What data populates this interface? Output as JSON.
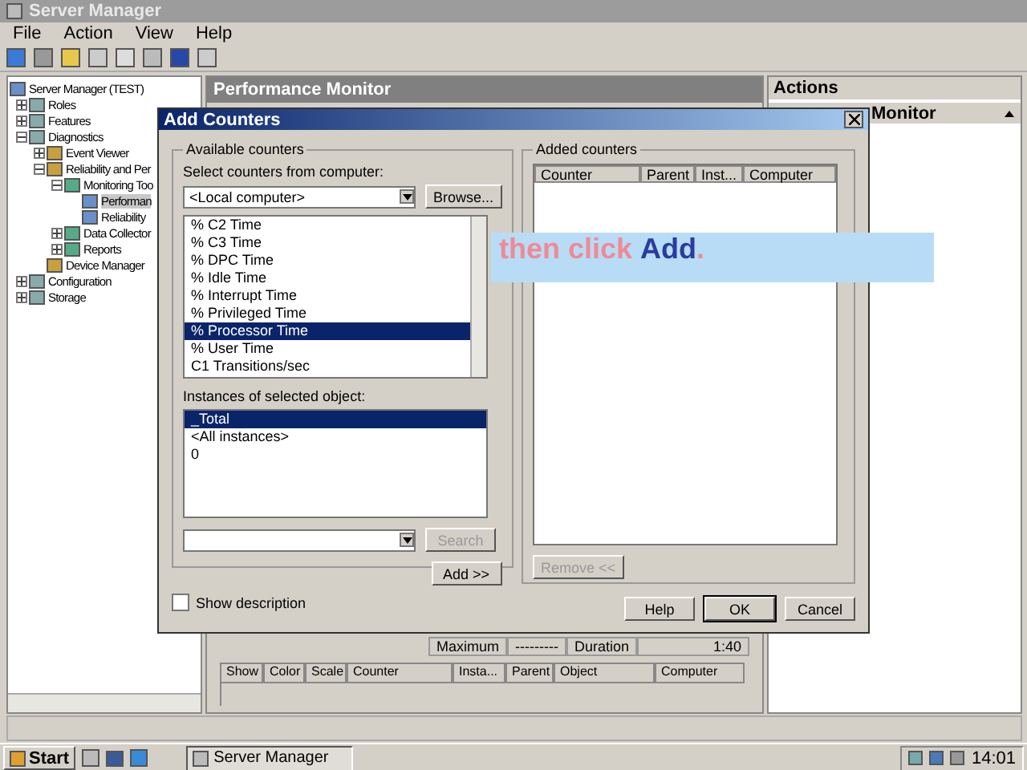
{
  "window": {
    "title": "Server Manager"
  },
  "menu": [
    "File",
    "Action",
    "View",
    "Help"
  ],
  "tree": [
    {
      "label": "Server Manager (TEST)",
      "selected": false,
      "children": [
        {
          "label": "Roles",
          "selected": false,
          "expanded": false
        },
        {
          "label": "Features",
          "selected": false,
          "expanded": false
        },
        {
          "label": "Diagnostics",
          "selected": false,
          "expanded": true,
          "children": [
            {
              "label": "Event Viewer",
              "selected": false,
              "expanded": false
            },
            {
              "label": "Reliability and Per",
              "selected": false,
              "expanded": true,
              "children": [
                {
                  "label": "Monitoring Too",
                  "selected": false,
                  "expanded": true,
                  "children": [
                    {
                      "label": "Performan",
                      "selected": true
                    },
                    {
                      "label": "Reliability",
                      "selected": false
                    }
                  ]
                },
                {
                  "label": "Data Collector",
                  "selected": false,
                  "expanded": false
                },
                {
                  "label": "Reports",
                  "selected": false,
                  "expanded": false
                }
              ]
            },
            {
              "label": "Device Manager",
              "selected": false
            }
          ]
        },
        {
          "label": "Configuration",
          "selected": false,
          "expanded": false
        },
        {
          "label": "Storage",
          "selected": false,
          "expanded": false
        }
      ]
    }
  ],
  "center": {
    "title": "Performance Monitor",
    "maximum_label": "Maximum",
    "maximum_value": "---------",
    "duration_label": "Duration",
    "duration_value": "1:40",
    "columns": [
      "Show",
      "Color",
      "Scale",
      "Counter",
      "Insta...",
      "Parent",
      "Object",
      "Computer"
    ]
  },
  "actions": {
    "title": "Actions",
    "item": "Monitor"
  },
  "dialog": {
    "title": "Add Counters",
    "available_label": "Available counters",
    "computer_label": "Select counters from computer:",
    "computer": "<Local computer>",
    "browse": "Browse...",
    "counters": [
      {
        "label": "% C2 Time",
        "selected": false
      },
      {
        "label": "% C3 Time",
        "selected": false
      },
      {
        "label": "% DPC Time",
        "selected": false
      },
      {
        "label": "% Idle Time",
        "selected": false
      },
      {
        "label": "% Interrupt Time",
        "selected": false
      },
      {
        "label": "% Privileged Time",
        "selected": false
      },
      {
        "label": "% Processor Time",
        "selected": true
      },
      {
        "label": "% User Time",
        "selected": false
      },
      {
        "label": "C1 Transitions/sec",
        "selected": false
      }
    ],
    "instances_label": "Instances of selected object:",
    "instances": [
      {
        "label": "_Total",
        "selected": true
      },
      {
        "label": "<All instances>",
        "selected": false
      },
      {
        "label": "0",
        "selected": false
      }
    ],
    "search": "Search",
    "add": "Add >>",
    "show_description": {
      "label": "Show description",
      "checked": false
    },
    "added_label": "Added counters",
    "added_columns": [
      "Counter",
      "Parent",
      "Inst...",
      "Computer"
    ],
    "remove": "Remove <<",
    "help": "Help",
    "ok": "OK",
    "cancel": "Cancel"
  },
  "caption": "then click **Add**.",
  "taskbar": {
    "start": "Start",
    "task": "Server Manager",
    "clock": "14:01"
  }
}
